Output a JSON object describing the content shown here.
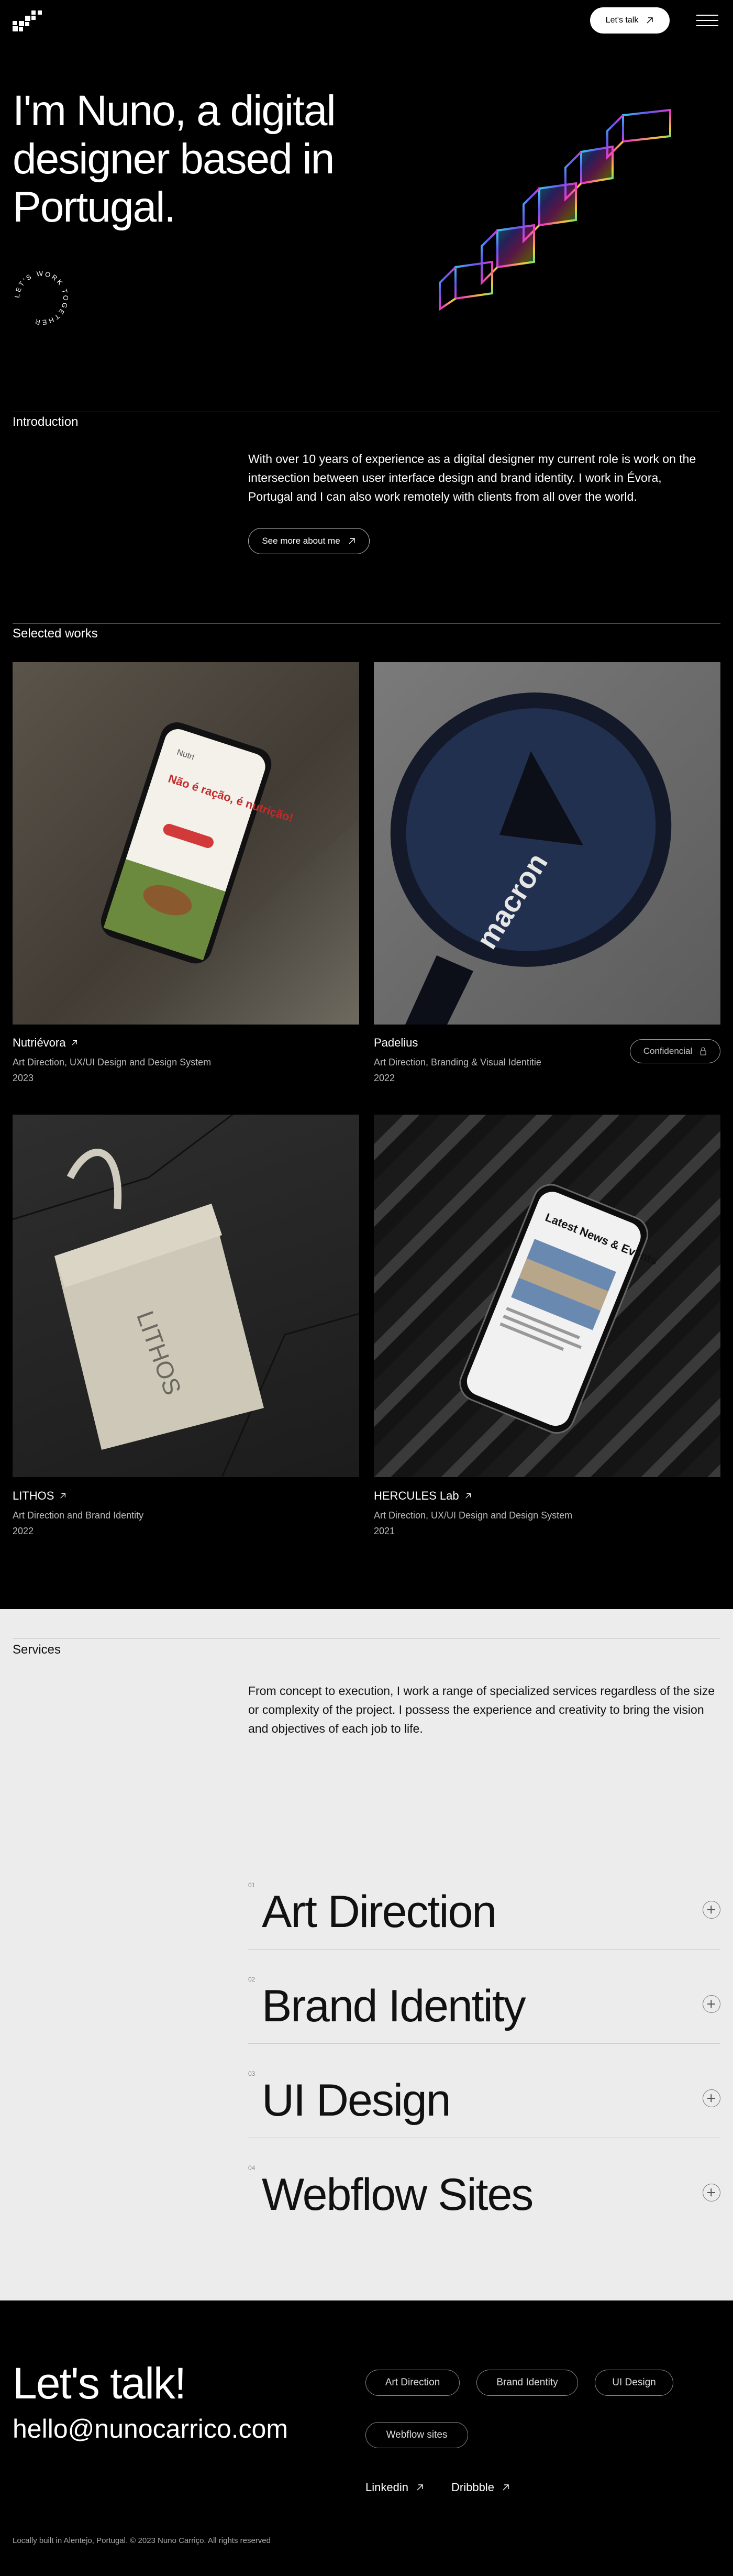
{
  "header": {
    "cta_label": "Let's talk",
    "logo_icon": "pixel-logo-icon",
    "menu_icon": "hamburger-menu-icon"
  },
  "hero": {
    "title": "I'm Nuno, a digital designer based in Portugal.",
    "badge_text": "LET'S WORK TOGETHER"
  },
  "intro": {
    "label": "Introduction",
    "text": "With over 10 years of experience as a digital designer my current role is work on the intersection between user interface design and brand identity. I work in Évora, Portugal and I can also work remotely with clients from all over the world.",
    "button_label": "See more about me"
  },
  "works": {
    "label": "Selected works",
    "items": [
      {
        "title": "Nutriévora",
        "subtitle": "Art Direction, UX/UI Design and Design System",
        "year": "2023",
        "screen_heading": "Não é ração, é nutrição!"
      },
      {
        "title": "Padelius",
        "subtitle": "Art Direction, Branding & Visual Identitie",
        "year": "2022",
        "badge": "Confidencial",
        "brand_text": "macron"
      },
      {
        "title": "LITHOS",
        "subtitle": "Art Direction and Brand Identity",
        "year": "2022",
        "brand_text": "LITHOS"
      },
      {
        "title": "HERCULES Lab",
        "subtitle": "Art Direction, UX/UI Design and Design System",
        "year": "2021",
        "screen_heading": "Latest News & Events"
      }
    ]
  },
  "services": {
    "label": "Services",
    "text": "From concept to execution, I work a range of specialized services regardless of the size or complexity of the project. I possess the experience and creativity to bring the vision and objectives of each job to life.",
    "items": [
      {
        "num": "01",
        "name": "Art Direction"
      },
      {
        "num": "02",
        "name": "Brand Identity"
      },
      {
        "num": "03",
        "name": "UI Design"
      },
      {
        "num": "04",
        "name": "Webflow Sites"
      }
    ]
  },
  "footer": {
    "heading": "Let's talk!",
    "email": "hello@nunocarrico.com",
    "tags": [
      "Art Direction",
      "Brand Identity",
      "UI Design",
      "Webflow sites"
    ],
    "socials": [
      "Linkedin",
      "Dribbble"
    ],
    "copyright": "Locally built in Alentejo, Portugal. © 2023 Nuno Carriço. All rights reserved"
  },
  "colors": {
    "background": "#000000",
    "services_bg": "#ececec",
    "accent": "#ffffff"
  }
}
